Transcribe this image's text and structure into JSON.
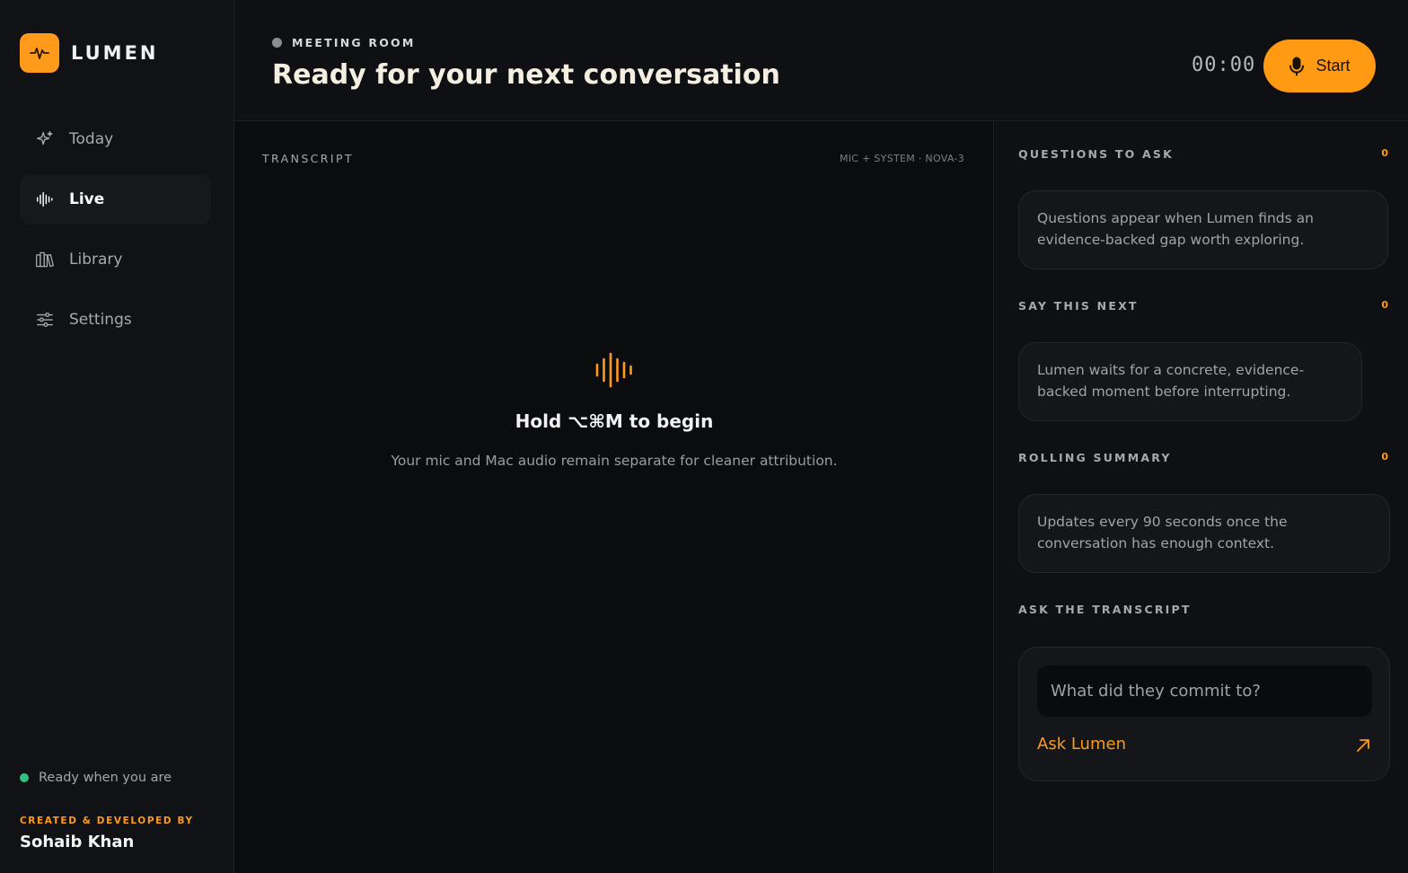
{
  "brand": {
    "name": "LUMEN"
  },
  "nav": {
    "items": [
      {
        "label": "Today",
        "icon": "sparkle-icon"
      },
      {
        "label": "Live",
        "icon": "waveform-icon",
        "active": true
      },
      {
        "label": "Library",
        "icon": "library-icon"
      },
      {
        "label": "Settings",
        "icon": "sliders-icon"
      }
    ]
  },
  "sidebar": {
    "status": "Ready when you are",
    "credit_label": "CREATED & DEVELOPED BY",
    "credit_name": "Sohaib Khan"
  },
  "header": {
    "room_label": "MEETING ROOM",
    "title": "Ready for your next conversation",
    "timer": "00:00",
    "start_label": "Start"
  },
  "transcript": {
    "label": "TRANSCRIPT",
    "meta": "MIC + SYSTEM · NOVA-3",
    "empty_title": "Hold ⌥⌘M to begin",
    "empty_sub": "Your mic and Mac audio remain separate for cleaner attribution."
  },
  "questions": {
    "label": "QUESTIONS TO ASK",
    "count": "0",
    "text": "Questions appear when Lumen finds an evidence-backed gap worth exploring."
  },
  "say_next": {
    "label": "SAY THIS NEXT",
    "count": "0",
    "text": "Lumen waits for a concrete, evidence-backed moment before interrupting."
  },
  "summary": {
    "label": "ROLLING SUMMARY",
    "count": "0",
    "text": "Updates every 90 seconds once the conversation has enough context."
  },
  "ask": {
    "label": "ASK THE TRANSCRIPT",
    "placeholder": "What did they commit to?",
    "link": "Ask Lumen"
  },
  "colors": {
    "accent": "#ff9a1a",
    "status_green": "#2fc27e",
    "background": "#0b0c0e"
  }
}
